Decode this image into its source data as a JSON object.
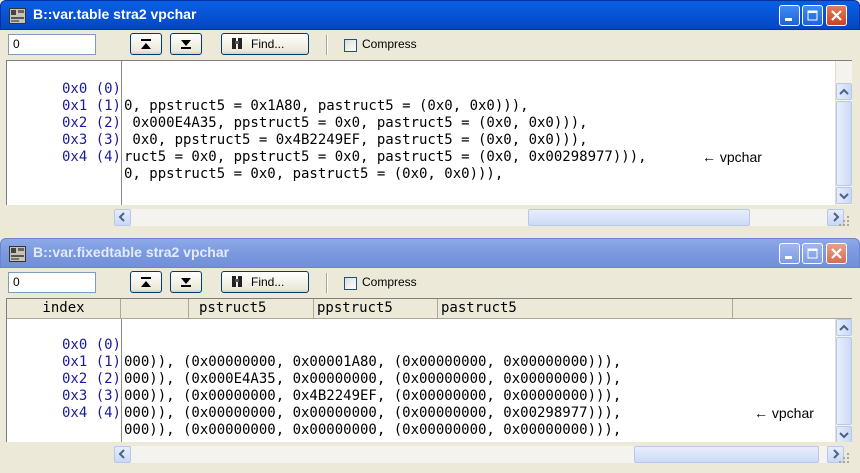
{
  "window1": {
    "title": "B::var.table stra2 vpchar",
    "toolbar": {
      "input_value": "0",
      "find_label": "Find...",
      "compress_label": "Compress"
    },
    "rows": [
      {
        "index": "0x0 (0)",
        "value": "0, ppstruct5 = 0x1A80, pastruct5 = (0x0, 0x0))),",
        "note": ""
      },
      {
        "index": "0x1 (1)",
        "value": " 0x000E4A35, ppstruct5 = 0x0, pastruct5 = (0x0, 0x0))),",
        "note": ""
      },
      {
        "index": "0x2 (2)",
        "value": " 0x0, ppstruct5 = 0x4B2249EF, pastruct5 = (0x0, 0x0))),",
        "note": "← vpchar"
      },
      {
        "index": "0x3 (3)",
        "value": "ruct5 = 0x0, ppstruct5 = 0x0, pastruct5 = (0x0, 0x00298977))),",
        "note": ""
      },
      {
        "index": "0x4 (4)",
        "value": "0, ppstruct5 = 0x0, pastruct5 = (0x0, 0x0))),",
        "note": ""
      }
    ]
  },
  "window2": {
    "title": "B::var.fixedtable stra2 vpchar",
    "toolbar": {
      "input_value": "0",
      "find_label": "Find...",
      "compress_label": "Compress"
    },
    "headers": [
      "index",
      "",
      "pstruct5",
      "ppstruct5",
      "pastruct5"
    ],
    "rows": [
      {
        "index": "0x0 (0)",
        "value": "000)), (0x00000000, 0x00001A80, (0x00000000, 0x00000000))),",
        "note": ""
      },
      {
        "index": "0x1 (1)",
        "value": "000)), (0x000E4A35, 0x00000000, (0x00000000, 0x00000000))),",
        "note": ""
      },
      {
        "index": "0x2 (2)",
        "value": "000)), (0x00000000, 0x4B2249EF, (0x00000000, 0x00000000))),",
        "note": "← vpchar"
      },
      {
        "index": "0x3 (3)",
        "value": "000)), (0x00000000, 0x00000000, (0x00000000, 0x00298977))),",
        "note": ""
      },
      {
        "index": "0x4 (4)",
        "value": "000)), (0x00000000, 0x00000000, (0x00000000, 0x00000000))),",
        "note": ""
      }
    ]
  },
  "icons": {
    "app": "trace32-app-icon",
    "minimize": "minimize-icon",
    "maximize": "maximize-icon",
    "close": "close-icon",
    "goto_top": "goto-top-icon",
    "goto_bottom": "goto-bottom-icon",
    "find": "binoculars-icon"
  },
  "colors": {
    "index_text": "#1a1a9a",
    "title_active": "#0756d8",
    "title_inactive": "#7a99e0"
  }
}
